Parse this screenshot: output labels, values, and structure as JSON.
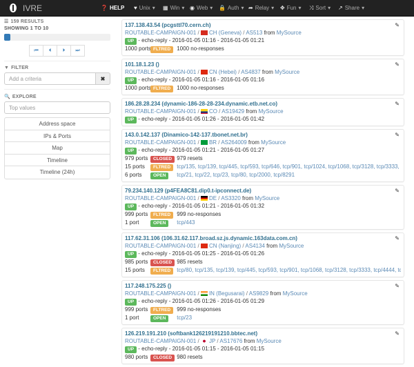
{
  "app": {
    "title": "IVRE"
  },
  "nav": [
    {
      "icon": "question-circle-icon",
      "glyph": "❓",
      "label": "HELP",
      "bold": true,
      "caret": false,
      "w": 48
    },
    {
      "icon": "heart-icon",
      "glyph": "♥",
      "label": "Unix",
      "caret": true,
      "w": 42
    },
    {
      "icon": "windows-icon",
      "glyph": "▦",
      "label": "Win",
      "caret": true,
      "w": 39
    },
    {
      "icon": "globe-icon",
      "glyph": "◉",
      "label": "Web",
      "caret": true,
      "w": 42
    },
    {
      "icon": "lock-icon",
      "glyph": "🔒",
      "label": "Auth",
      "caret": true,
      "w": 43
    },
    {
      "icon": "share-arrow-icon",
      "glyph": "➦",
      "label": "Relay",
      "caret": true,
      "w": 46
    },
    {
      "icon": "move-icon",
      "glyph": "✥",
      "label": "Fun",
      "caret": true,
      "w": 42
    },
    {
      "icon": "random-icon",
      "glyph": "⤨",
      "label": "Sort",
      "caret": true,
      "w": 42
    },
    {
      "icon": "share-icon",
      "glyph": "↗",
      "label": "Share",
      "caret": true,
      "w": 42
    }
  ],
  "sidebar": {
    "results": "159 RESULTS",
    "showing": "SHOWING 1 TO 10",
    "progress": 0.06,
    "pager": [
      "⏮",
      "⏴",
      "⏵",
      "⏭"
    ],
    "filter_title": "FILTER",
    "filter_placeholder": "Add a criteria",
    "clear": "✖",
    "explore_title": "EXPLORE",
    "top_values_placeholder": "Top values",
    "explore_items": [
      "Address space",
      "IPs & Ports",
      "Map",
      "Timeline",
      "Timeline (24h)"
    ]
  },
  "hosts": [
    {
      "ip": "137.138.43.54",
      "host": "(pcgsttl70.cern.ch)",
      "campaign": "ROUTABLE-CAMPAIGN-001",
      "flag": "ch",
      "loc": "CH (Geneva)",
      "as": "AS513",
      "source": "MySource",
      "state": "UP",
      "reason": "echo-reply",
      "start": "2016-01-05 01:16",
      "end": "2016-01-05 01:21",
      "ports": [
        {
          "count": "1000 ports",
          "status": "filtered",
          "label": "FLTRED",
          "detail": "1000 no-responses"
        }
      ]
    },
    {
      "ip": "101.18.1.23",
      "host": "()",
      "campaign": "ROUTABLE-CAMPAIGN-001",
      "flag": "cn",
      "loc": "CN (Hebei)",
      "as": "AS4837",
      "source": "MySource",
      "state": "UP",
      "reason": "echo-reply",
      "start": "2016-01-05 01:16",
      "end": "2016-01-05 01:16",
      "ports": [
        {
          "count": "1000 ports",
          "status": "filtered",
          "label": "FLTRED",
          "detail": "1000 no-responses"
        }
      ]
    },
    {
      "ip": "186.28.28.234",
      "host": "(dynamic-186-28-28-234.dynamic.etb.net.co)",
      "campaign": "ROUTABLE-CAMPAIGN-001",
      "flag": "co",
      "loc": "CO",
      "as": "AS19429",
      "source": "MySource",
      "state": "UP",
      "reason": "echo-reply",
      "start": "2016-01-05 01:26",
      "end": "2016-01-05 01:42",
      "ports": []
    },
    {
      "ip": "143.0.142.137",
      "host": "(Dinamico-142-137.tbonet.net.br)",
      "campaign": "ROUTABLE-CAMPAIGN-001",
      "flag": "br",
      "loc": "BR",
      "as": "AS264009",
      "source": "MySource",
      "state": "UP",
      "reason": "echo-reply",
      "start": "2016-01-05 01:21",
      "end": "2016-01-05 01:27",
      "ports": [
        {
          "count": "979 ports",
          "status": "closed",
          "label": "CLOSED",
          "detail": "979 resets"
        },
        {
          "count": "15 ports",
          "status": "filtered",
          "label": "FLTRED",
          "detail": "tcp/135, tcp/139, tcp/445, tcp/593, tcp/646, tcp/901, tcp/1024, tcp/1068, tcp/3128, tcp/3333, tcp/4",
          "link": true
        },
        {
          "count": "6 ports",
          "status": "open",
          "label": "OPEN",
          "detail": "tcp/21, tcp/22, tcp/23, tcp/80, tcp/2000, tcp/8291",
          "link": true
        }
      ]
    },
    {
      "ip": "79.234.140.129",
      "host": "(p4FEA8C81.dip0.t-ipconnect.de)",
      "campaign": "ROUTABLE-CAMPAIGN-001",
      "flag": "de",
      "loc": "DE",
      "as": "AS3320",
      "source": "MySource",
      "state": "UP",
      "reason": "echo-reply",
      "start": "2016-01-05 01:21",
      "end": "2016-01-05 01:32",
      "ports": [
        {
          "count": "999 ports",
          "status": "filtered",
          "label": "FLTRED",
          "detail": "999 no-responses"
        },
        {
          "count": "1 port",
          "status": "open",
          "label": "OPEN",
          "detail": "tcp/443",
          "link": true
        }
      ]
    },
    {
      "ip": "117.62.31.106",
      "host": "(106.31.62.117.broad.sz.js.dynamic.163data.com.cn)",
      "campaign": "ROUTABLE-CAMPAIGN-001",
      "flag": "cn",
      "loc": "CN (Nanjing)",
      "as": "AS4134",
      "source": "MySource",
      "state": "UP",
      "reason": "echo-reply",
      "start": "2016-01-05 01:25",
      "end": "2016-01-05 01:26",
      "ports": [
        {
          "count": "985 ports",
          "status": "closed",
          "label": "CLOSED",
          "detail": "985 resets"
        },
        {
          "count": "15 ports",
          "status": "filtered",
          "label": "FLTRED",
          "detail": "tcp/80, tcp/135, tcp/139, tcp/445, tcp/593, tcp/901, tcp/1068, tcp/3128, tcp/3333, tcp/4444, tcp/58",
          "link": true
        }
      ]
    },
    {
      "ip": "117.248.175.225",
      "host": "()",
      "campaign": "ROUTABLE-CAMPAIGN-001",
      "flag": "in",
      "loc": "IN (Begusarai)",
      "as": "AS9829",
      "source": "MySource",
      "state": "UP",
      "reason": "echo-reply",
      "start": "2016-01-05 01:26",
      "end": "2016-01-05 01:29",
      "ports": [
        {
          "count": "999 ports",
          "status": "filtered",
          "label": "FLTRED",
          "detail": "999 no-responses"
        },
        {
          "count": "1 port",
          "status": "open",
          "label": "OPEN",
          "detail": "tcp/23",
          "link": true
        }
      ]
    },
    {
      "ip": "126.219.191.210",
      "host": "(softbank126219191210.bbtec.net)",
      "campaign": "ROUTABLE-CAMPAIGN-001",
      "flag": "jp",
      "loc": "JP",
      "as": "AS17676",
      "source": "MySource",
      "state": "UP",
      "reason": "echo-reply",
      "start": "2016-01-05 01:15",
      "end": "2016-01-05 01:15",
      "ports": [
        {
          "count": "980 ports",
          "status": "closed",
          "label": "CLOSED",
          "detail": "980 resets"
        }
      ]
    }
  ]
}
